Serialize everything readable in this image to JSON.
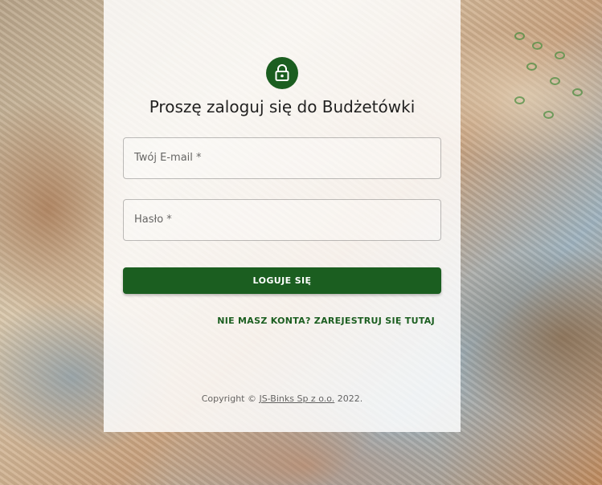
{
  "login": {
    "icon": "lock-icon",
    "accent_color": "#1b5e20",
    "title": "Proszę zaloguj się do Budżetówki",
    "email_label": "Twój E-mail *",
    "password_label": "Hasło *",
    "submit_label": "LOGUJE SIĘ",
    "register_link": "NIE MASZ KONTA? ZAREJESTRUJ SIĘ TUTAJ"
  },
  "footer": {
    "copyright_prefix": "Copyright © ",
    "company_link": "JS-Binks Sp z o.o.",
    "copyright_suffix": " 2022."
  }
}
